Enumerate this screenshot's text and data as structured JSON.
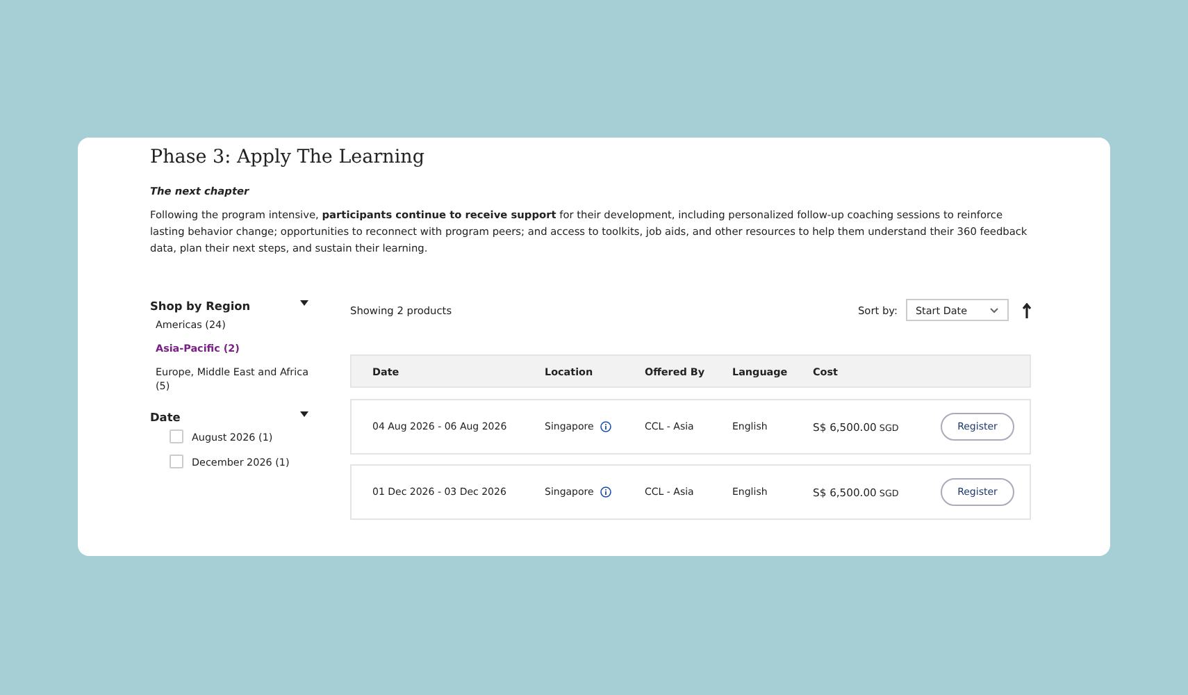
{
  "heading": "Phase 3: Apply The Learning",
  "subheading": "The next chapter",
  "description": "Following the program intensive, **participants continue to receive support** for their development, including personalized follow-up coaching sessions to reinforce lasting behavior change; opportunities  to reconnect with program peers; and access to toolkits, job aids, and other resources to help them understand their 360 feedback data, plan their next steps, and sustain their learning.",
  "filters": [
    {
      "title": "Shop by Region",
      "kind": "links",
      "items": [
        {
          "label": "Americas (24)",
          "selected": false
        },
        {
          "label": "Asia-Pacific (2)",
          "selected": true
        },
        {
          "label": "Europe, Middle East and Africa (5)",
          "selected": false
        }
      ]
    },
    {
      "title": "Date",
      "kind": "checkboxes",
      "items": [
        {
          "label": "August 2026 (1)",
          "checked": false
        },
        {
          "label": "December 2026 (1)",
          "checked": false
        }
      ]
    }
  ],
  "result_count": "Showing 2 products",
  "sort": {
    "label": "Sort by:",
    "value": "Start Date"
  },
  "table": {
    "columns": [
      "Date",
      "Location",
      "Offered By",
      "Language",
      "Cost"
    ],
    "rows": [
      {
        "date": "04 Aug 2026 - 06 Aug 2026",
        "location": "Singapore",
        "offered_by": "CCL - Asia",
        "language": "English",
        "cost": "S$ 6,500.00",
        "currency": "SGD",
        "action": "Register"
      },
      {
        "date": "01 Dec 2026 - 03 Dec 2026",
        "location": "Singapore",
        "offered_by": "CCL - Asia",
        "language": "English",
        "cost": "S$ 6,500.00",
        "currency": "SGD",
        "action": "Register"
      }
    ]
  }
}
